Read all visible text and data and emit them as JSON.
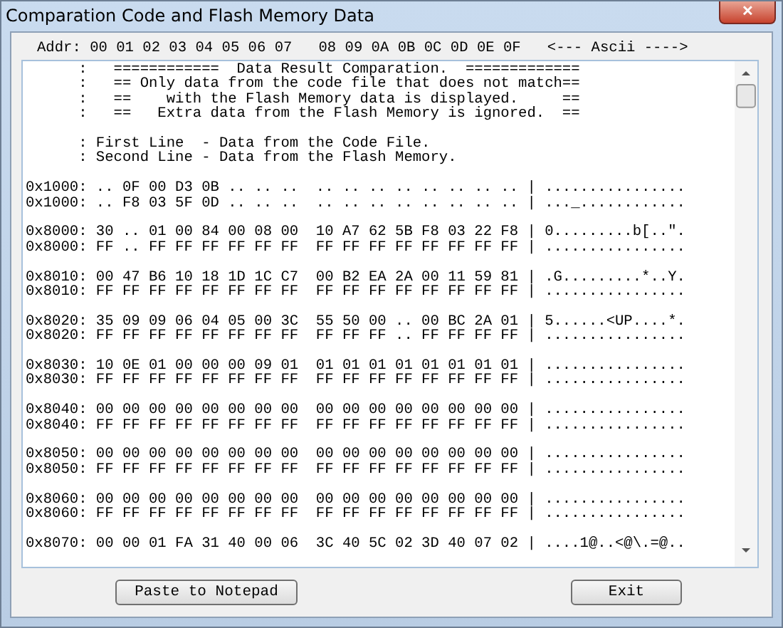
{
  "window": {
    "title": "Comparation Code and Flash Memory Data",
    "close_label": "✕"
  },
  "header": "Addr: 00 01 02 03 04 05 06 07   08 09 0A 0B 0C 0D 0E 0F   <--- Ascii ---->",
  "notes": [
    "      :   ============  Data Result Comparation.  =============",
    "      :   == Only data from the code file that does not match==",
    "      :   ==    with the Flash Memory data is displayed.     ==",
    "      :   ==   Extra data from the Flash Memory is ignored.  =="
  ],
  "legend": [
    "      : First Line  - Data from the Code File.",
    "      : Second Line - Data from the Flash Memory."
  ],
  "groups": [
    {
      "lines": [
        "0x1000: .. 0F 00 D3 0B .. .. ..  .. .. .. .. .. .. .. .. | ................",
        "0x1000: .. F8 03 5F 0D .. .. ..  .. .. .. .. .. .. .. .. | ..._............"
      ]
    },
    {
      "lines": [
        "0x8000: 30 .. 01 00 84 00 08 00  10 A7 62 5B F8 03 22 F8 | 0.........b[..\".",
        "0x8000: FF .. FF FF FF FF FF FF  FF FF FF FF FF FF FF FF | ................"
      ]
    },
    {
      "lines": [
        "0x8010: 00 47 B6 10 18 1D 1C C7  00 B2 EA 2A 00 11 59 81 | .G.........*..Y.",
        "0x8010: FF FF FF FF FF FF FF FF  FF FF FF FF FF FF FF FF | ................"
      ]
    },
    {
      "lines": [
        "0x8020: 35 09 09 06 04 05 00 3C  55 50 00 .. 00 BC 2A 01 | 5......<UP....*.",
        "0x8020: FF FF FF FF FF FF FF FF  FF FF FF .. FF FF FF FF | ................"
      ]
    },
    {
      "lines": [
        "0x8030: 10 0E 01 00 00 00 09 01  01 01 01 01 01 01 01 01 | ................",
        "0x8030: FF FF FF FF FF FF FF FF  FF FF FF FF FF FF FF FF | ................"
      ]
    },
    {
      "lines": [
        "0x8040: 00 00 00 00 00 00 00 00  00 00 00 00 00 00 00 00 | ................",
        "0x8040: FF FF FF FF FF FF FF FF  FF FF FF FF FF FF FF FF | ................"
      ]
    },
    {
      "lines": [
        "0x8050: 00 00 00 00 00 00 00 00  00 00 00 00 00 00 00 00 | ................",
        "0x8050: FF FF FF FF FF FF FF FF  FF FF FF FF FF FF FF FF | ................"
      ]
    },
    {
      "lines": [
        "0x8060: 00 00 00 00 00 00 00 00  00 00 00 00 00 00 00 00 | ................",
        "0x8060: FF FF FF FF FF FF FF FF  FF FF FF FF FF FF FF FF | ................"
      ]
    },
    {
      "lines": [
        "0x8070: 00 00 01 FA 31 40 00 06  3C 40 5C 02 3D 40 07 02 | ....1@..<@\\.=@.."
      ]
    }
  ],
  "buttons": [
    {
      "label": "Paste to Notepad"
    },
    {
      "label": "Exit"
    }
  ]
}
